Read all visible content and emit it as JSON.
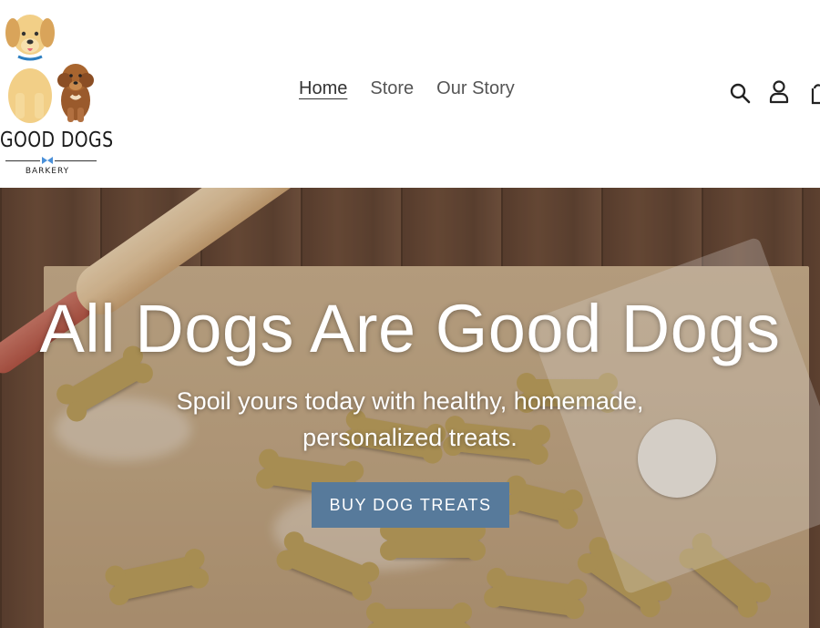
{
  "brand": {
    "name": "GOOD DOGS",
    "tagline": "BARKERY"
  },
  "nav": {
    "items": [
      {
        "label": "Home",
        "active": true
      },
      {
        "label": "Store",
        "active": false
      },
      {
        "label": "Our Story",
        "active": false
      }
    ]
  },
  "header_icons": [
    "search-icon",
    "account-icon",
    "cart-icon"
  ],
  "hero": {
    "title": "All Dogs Are Good Dogs",
    "subtitle": "Spoil yours today with healthy, homemade, personalized treats.",
    "cta_label": "BUY DOG TREATS"
  },
  "colors": {
    "cta": "#577a9b",
    "nav_text": "#555555",
    "logo_bow": "#4a90d9"
  }
}
